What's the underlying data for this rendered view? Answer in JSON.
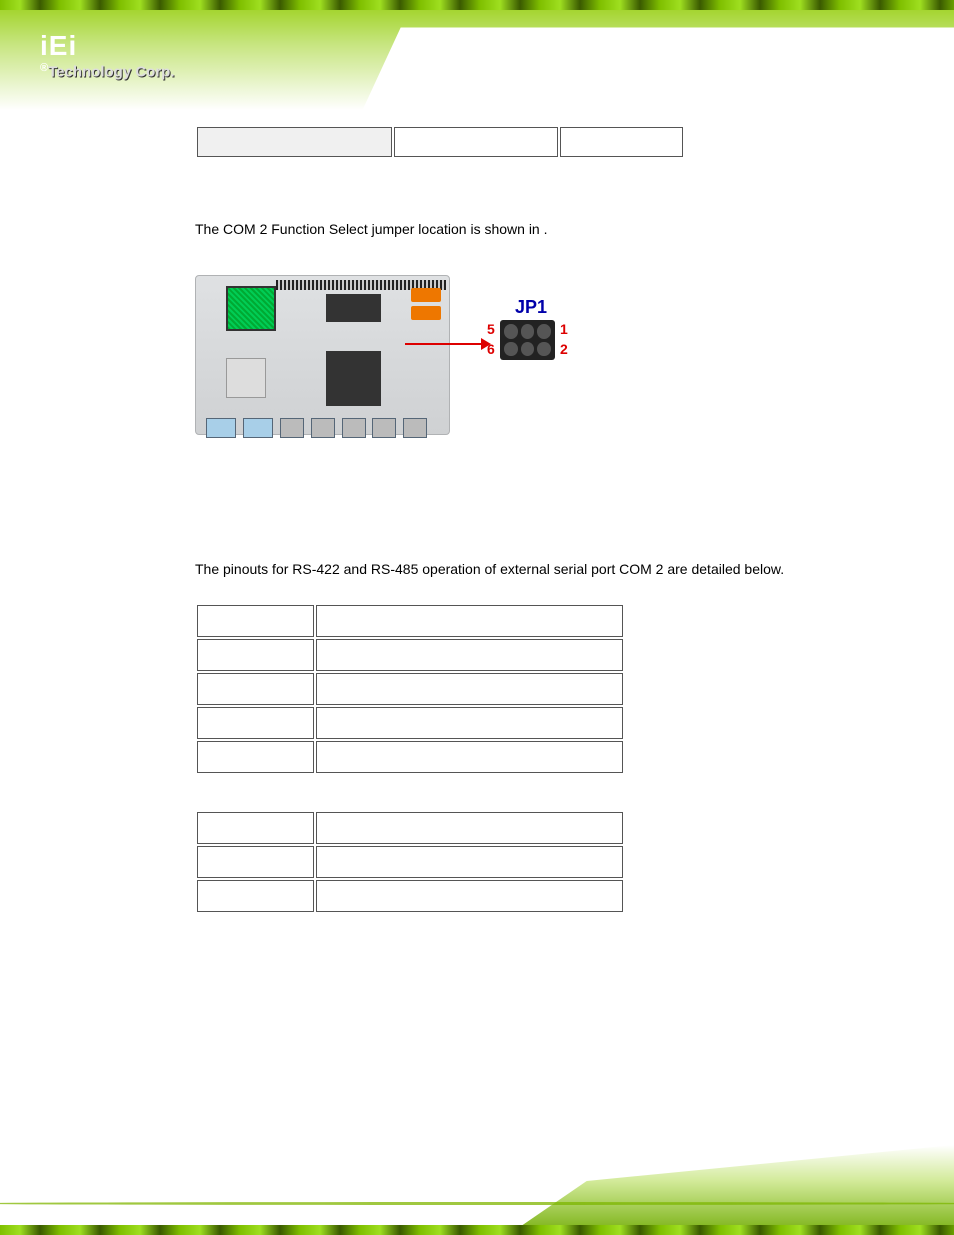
{
  "logo": {
    "brand": "iEi",
    "reg": "®",
    "tagline": "Technology Corp."
  },
  "jumper_table": {
    "col1": "",
    "col2": "",
    "col3": ""
  },
  "para1_prefix": "The COM 2 Function Select jumper location is shown in ",
  "para1_suffix": ".",
  "figure": {
    "jp_label": "JP1",
    "pin5": "5",
    "pin6": "6",
    "pin1": "1",
    "pin2": "2"
  },
  "para2": "The pinouts for RS-422 and RS-485 operation of external serial port COM 2 are detailed below.",
  "rs422_table": {
    "rows": [
      {
        "pin": "",
        "desc": ""
      },
      {
        "pin": "",
        "desc": ""
      },
      {
        "pin": "",
        "desc": ""
      },
      {
        "pin": "",
        "desc": ""
      },
      {
        "pin": "",
        "desc": ""
      }
    ]
  },
  "rs485_table": {
    "rows": [
      {
        "pin": "",
        "desc": ""
      },
      {
        "pin": "",
        "desc": ""
      },
      {
        "pin": "",
        "desc": ""
      }
    ]
  }
}
